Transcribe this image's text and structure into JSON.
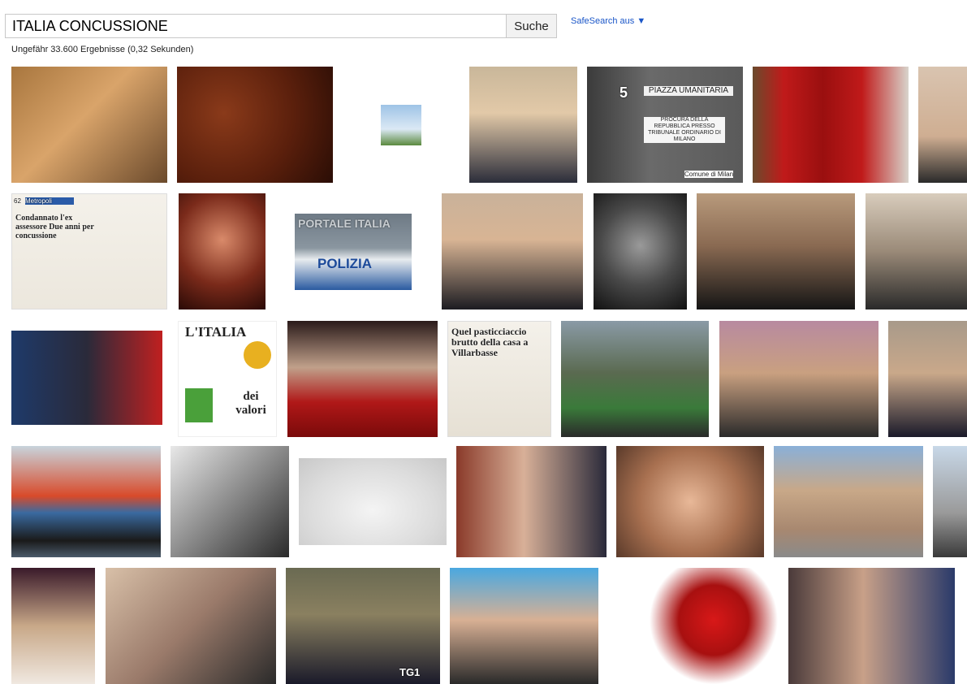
{
  "search": {
    "query": "ITALIA CONCUSSIONE",
    "button_label": "Suche",
    "safesearch_label": "SafeSearch aus ▼",
    "result_stats": "Ungefähr 33.600 Ergebnisse (0,32 Sekunden)"
  },
  "thumbnail_text": {
    "umanitaria_number": "5",
    "umanitaria_sign": "PIAZZA UMANITARIA",
    "procura_sign": "PROCURA DELLA REPUBBLICA PRESSO TRIBUNALE ORDINARIO DI MILANO",
    "comune_sign": "Comune di Milano",
    "newspaper_page": "62",
    "newspaper_section": "Metropoli",
    "newspaper_headline": "Condannato l'ex assessore Due anni per concussione",
    "watermark": "PORTALE ITALIA",
    "polizia": "POLIZIA",
    "italia_dei_valori_top": "L'ITALIA",
    "italia_dei_valori_bottom": "dei valori",
    "villarbasse_headline": "Quel pasticciaccio brutto della casa a Villarbasse",
    "tg_logo": "TG1"
  },
  "colors": {
    "link_blue": "#1a56c8",
    "button_bg": "#f2f2f2",
    "border_gray": "#c8c8c8"
  }
}
